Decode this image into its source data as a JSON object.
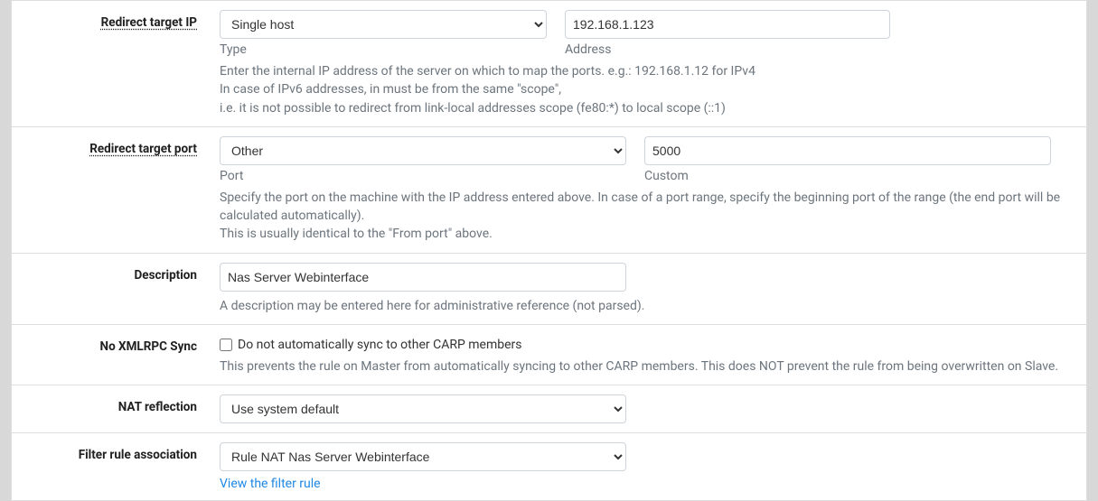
{
  "redirect_target_ip": {
    "label": "Redirect target IP",
    "type_value": "Single host",
    "type_sub": "Type",
    "address_value": "192.168.1.123",
    "address_sub": "Address",
    "help1": "Enter the internal IP address of the server on which to map the ports. e.g.: 192.168.1.12 for IPv4",
    "help2": "In case of IPv6 addresses, in must be from the same \"scope\",",
    "help3": "i.e. it is not possible to redirect from link-local addresses scope (fe80:*) to local scope (::1)"
  },
  "redirect_target_port": {
    "label": "Redirect target port",
    "port_value": "Other",
    "port_sub": "Port",
    "custom_value": "5000",
    "custom_sub": "Custom",
    "help1": "Specify the port on the machine with the IP address entered above. In case of a port range, specify the beginning port of the range (the end port will be calculated automatically).",
    "help2": "This is usually identical to the \"From port\" above."
  },
  "description": {
    "label": "Description",
    "value": "Nas Server Webinterface",
    "help": "A description may be entered here for administrative reference (not parsed)."
  },
  "no_xmlrpc": {
    "label": "No XMLRPC Sync",
    "checkbox_label": "Do not automatically sync to other CARP members",
    "help": "This prevents the rule on Master from automatically syncing to other CARP members. This does NOT prevent the rule from being overwritten on Slave."
  },
  "nat_reflection": {
    "label": "NAT reflection",
    "value": "Use system default"
  },
  "filter_rule_assoc": {
    "label": "Filter rule association",
    "value": "Rule NAT Nas Server Webinterface",
    "link": "View the filter rule"
  }
}
